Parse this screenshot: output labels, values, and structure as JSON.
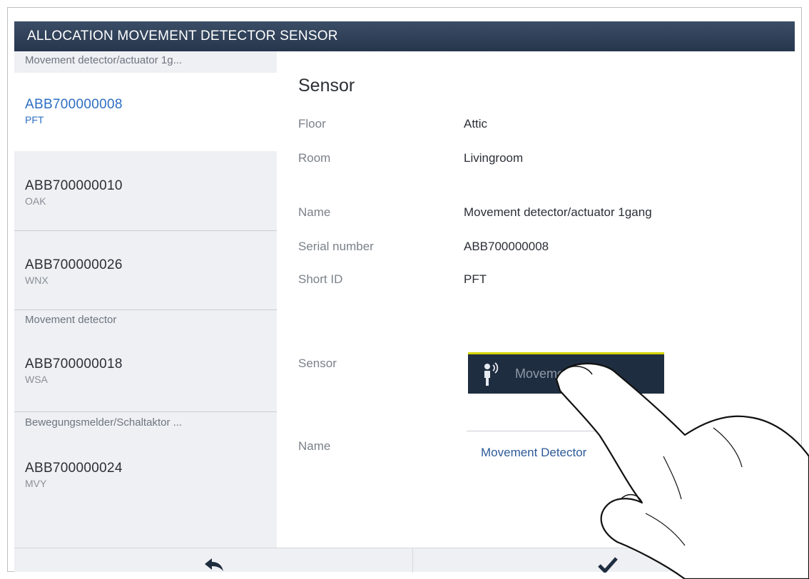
{
  "title": "ALLOCATION MOVEMENT DETECTOR SENSOR",
  "sidebar": {
    "groups": [
      {
        "label": "Movement detector/actuator 1g..."
      },
      {
        "label": "Movement detector"
      },
      {
        "label": "Bewegungsmelder/Schaltaktor ..."
      }
    ],
    "items": [
      {
        "code": "ABB700000008",
        "sub": "PFT",
        "selected": true
      },
      {
        "code": "ABB700000010",
        "sub": "OAK"
      },
      {
        "code": "ABB700000026",
        "sub": "WNX"
      },
      {
        "code": "ABB700000018",
        "sub": "WSA"
      },
      {
        "code": "ABB700000024",
        "sub": "MVY"
      }
    ]
  },
  "detail": {
    "heading": "Sensor",
    "floor_label": "Floor",
    "floor_value": "Attic",
    "room_label": "Room",
    "room_value": "Livingroom",
    "name_label": "Name",
    "name_value": "Movement detector/actuator 1gang",
    "serial_label": "Serial number",
    "serial_value": "ABB700000008",
    "shortid_label": "Short ID",
    "shortid_value": "PFT",
    "sensor_label": "Sensor",
    "sensor_button": "Movement detec...",
    "name2_label": "Name",
    "name2_value": "Movement Detector"
  },
  "icons": {
    "back": "back-arrow-icon",
    "confirm": "checkmark-icon",
    "sensor": "movement-detector-icon"
  },
  "colors": {
    "titlebar": "#26364d",
    "accent_yellow": "#d4d400",
    "selected_text": "#2d6ec2"
  }
}
